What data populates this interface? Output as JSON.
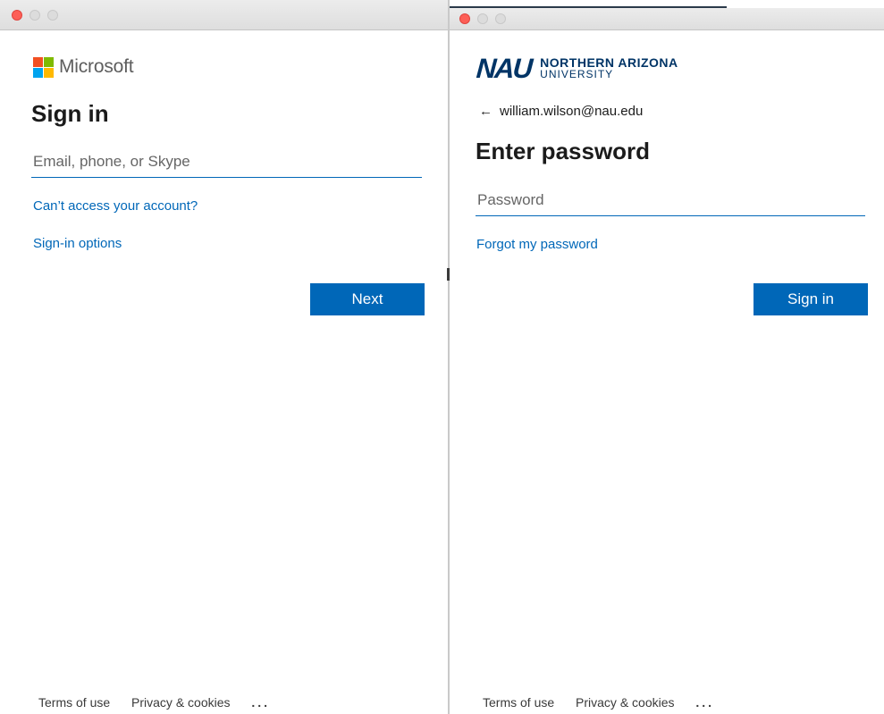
{
  "left": {
    "brand": "Microsoft",
    "heading": "Sign in",
    "input_placeholder": "Email, phone, or Skype",
    "link_cant_access": "Can’t access your account?",
    "link_signin_options": "Sign-in options",
    "next_button": "Next",
    "footer": {
      "terms": "Terms of use",
      "privacy": "Privacy & cookies",
      "more": "..."
    }
  },
  "right": {
    "logo": {
      "mark": "NAU",
      "line1": "NORTHERN ARIZONA",
      "line2": "UNIVERSITY"
    },
    "back_arrow": "←",
    "account_email": "william.wilson@nau.edu",
    "heading": "Enter password",
    "password_placeholder": "Password",
    "link_forgot": "Forgot my password",
    "signin_button": "Sign in",
    "footer": {
      "terms": "Terms of use",
      "privacy": "Privacy & cookies",
      "more": "..."
    }
  },
  "colors": {
    "accent": "#0067b8",
    "ms_red": "#f25022",
    "ms_green": "#7fba00",
    "ms_blue": "#00a4ef",
    "ms_yellow": "#ffb900",
    "nau_navy": "#003466",
    "nau_gold": "#f7b21f"
  }
}
